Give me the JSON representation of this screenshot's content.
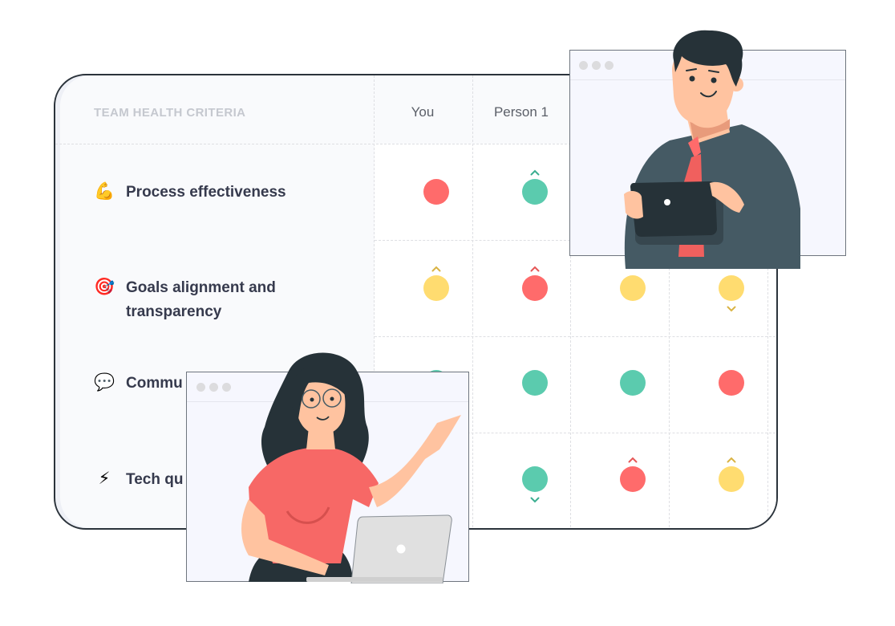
{
  "table": {
    "criteria_header": "TEAM HEALTH CRITERIA",
    "columns": [
      "You",
      "Person 1",
      "",
      ""
    ],
    "rows": [
      {
        "icon": "flexed-biceps-icon",
        "emoji": "💪",
        "label": "Process effectiveness",
        "cells": [
          {
            "status": "red",
            "trend": "none"
          },
          {
            "status": "green",
            "trend": "up"
          },
          {
            "status": "hidden",
            "trend": "none"
          },
          {
            "status": "hidden",
            "trend": "none"
          }
        ]
      },
      {
        "icon": "direct-hit-target-icon",
        "emoji": "🎯",
        "label": "Goals alignment and transparency",
        "cells": [
          {
            "status": "yellow",
            "trend": "up"
          },
          {
            "status": "red",
            "trend": "up"
          },
          {
            "status": "yellow",
            "trend": "none"
          },
          {
            "status": "yellow",
            "trend": "down"
          }
        ]
      },
      {
        "icon": "speech-balloon-icon",
        "emoji": "💬",
        "label": "Commu",
        "cells": [
          {
            "status": "green",
            "trend": "none"
          },
          {
            "status": "green",
            "trend": "none"
          },
          {
            "status": "green",
            "trend": "none"
          },
          {
            "status": "red",
            "trend": "none"
          }
        ]
      },
      {
        "icon": "lightning-bolt-icon",
        "emoji": "⚡",
        "label": "Tech qu",
        "cells": [
          {
            "status": "hidden",
            "trend": "none"
          },
          {
            "status": "green",
            "trend": "down"
          },
          {
            "status": "red",
            "trend": "up"
          },
          {
            "status": "yellow",
            "trend": "up"
          }
        ]
      }
    ]
  },
  "colors": {
    "red": "#ff6b6b",
    "green": "#5bcbae",
    "yellow": "#ffdc70",
    "red_chevron": "#e65757",
    "green_chevron": "#3bae90",
    "yellow_chevron": "#d9b344",
    "card_border": "#2b333b",
    "label_text": "#363a4d",
    "header_text": "#c5c8cf"
  },
  "windows": [
    {
      "name": "man-with-tablet-window",
      "illustration": "man-with-tablet"
    },
    {
      "name": "woman-with-laptop-window",
      "illustration": "woman-with-laptop"
    }
  ]
}
